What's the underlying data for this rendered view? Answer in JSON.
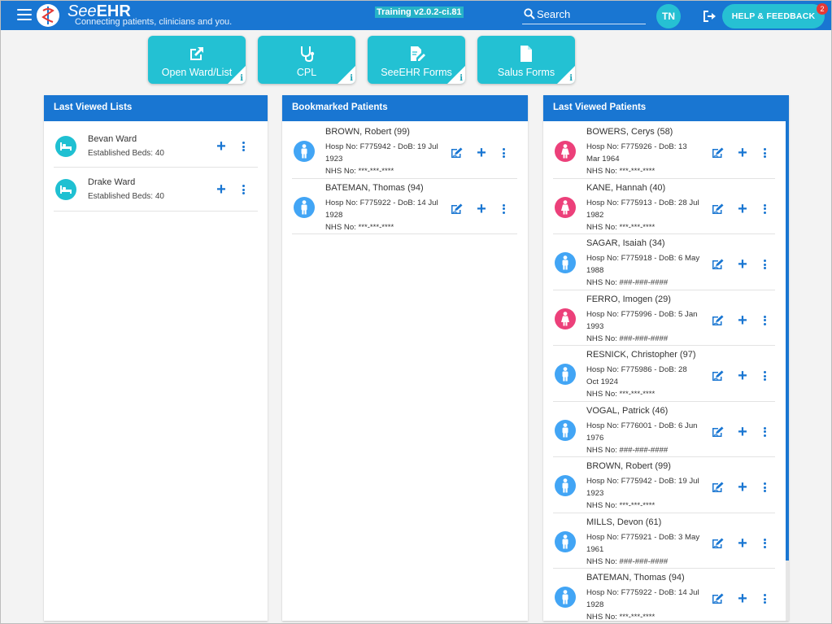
{
  "header": {
    "brand_prefix": "See",
    "brand_bold": "EHR",
    "tagline": "Connecting patients, clinicians and you.",
    "version": "Training v2.0.2-ci.81",
    "search_label": "Search",
    "avatar_initials": "TN",
    "help_label": "HELP & FEEDBACK",
    "help_badge": "2"
  },
  "tiles": [
    {
      "label": "Open Ward/List",
      "icon": "external-link-icon"
    },
    {
      "label": "CPL",
      "icon": "stethoscope-icon"
    },
    {
      "label": "SeeEHR Forms",
      "icon": "edit-form-icon"
    },
    {
      "label": "Salus Forms",
      "icon": "document-icon"
    }
  ],
  "tile_info": "i",
  "last_viewed_lists": {
    "title": "Last Viewed Lists",
    "items": [
      {
        "name": "Bevan Ward",
        "beds": "Established Beds: 40"
      },
      {
        "name": "Drake Ward",
        "beds": "Established Beds: 40"
      }
    ]
  },
  "bookmarked": {
    "title": "Bookmarked Patients",
    "items": [
      {
        "name": "BROWN, Robert (99)",
        "detail": "Hosp No: F775942 - DoB: 19 Jul 1923",
        "nhs": "NHS No: ***-***-****",
        "sex": "male"
      },
      {
        "name": "BATEMAN, Thomas (94)",
        "detail": "Hosp No: F775922 - DoB: 14 Jul 1928",
        "nhs": "NHS No: ***-***-****",
        "sex": "male"
      }
    ]
  },
  "last_viewed_patients": {
    "title": "Last Viewed Patients",
    "items": [
      {
        "name": "BOWERS, Cerys (58)",
        "detail": "Hosp No: F775926 - DoB: 13 Mar 1964",
        "nhs": "NHS No: ***-***-****",
        "sex": "female"
      },
      {
        "name": "KANE, Hannah (40)",
        "detail": "Hosp No: F775913 - DoB: 28 Jul 1982",
        "nhs": "NHS No: ***-***-****",
        "sex": "female"
      },
      {
        "name": "SAGAR, Isaiah (34)",
        "detail": "Hosp No: F775918 - DoB: 6 May 1988",
        "nhs": "NHS No: ###-###-####",
        "sex": "male"
      },
      {
        "name": "FERRO, Imogen (29)",
        "detail": "Hosp No: F775996 - DoB: 5 Jan 1993",
        "nhs": "NHS No: ###-###-####",
        "sex": "female"
      },
      {
        "name": "RESNICK, Christopher (97)",
        "detail": "Hosp No: F775986 - DoB: 28 Oct 1924",
        "nhs": "NHS No: ***-***-****",
        "sex": "male"
      },
      {
        "name": "VOGAL, Patrick (46)",
        "detail": "Hosp No: F776001 - DoB: 6 Jun 1976",
        "nhs": "NHS No: ###-###-####",
        "sex": "male"
      },
      {
        "name": "BROWN, Robert (99)",
        "detail": "Hosp No: F775942 - DoB: 19 Jul 1923",
        "nhs": "NHS No: ***-***-****",
        "sex": "male"
      },
      {
        "name": "MILLS, Devon (61)",
        "detail": "Hosp No: F775921 - DoB: 3 May 1961",
        "nhs": "NHS No: ###-###-####",
        "sex": "male"
      },
      {
        "name": "BATEMAN, Thomas (94)",
        "detail": "Hosp No: F775922 - DoB: 14 Jul 1928",
        "nhs": "NHS No: ***-***-****",
        "sex": "male"
      }
    ]
  },
  "colors": {
    "male": "#42a5f5",
    "female": "#ec407a",
    "primary": "#1976d2",
    "accent": "#23c1d3"
  }
}
